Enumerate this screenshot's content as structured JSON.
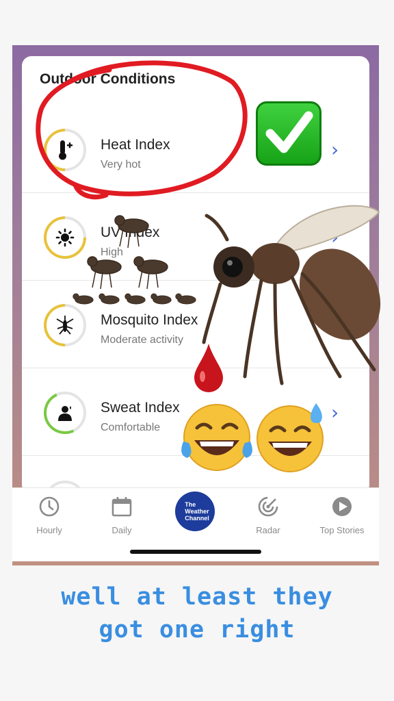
{
  "panel": {
    "title": "Outdoor Conditions",
    "rows": [
      {
        "title": "Heat Index",
        "subtitle": "Very hot",
        "icon": "thermometer-icon",
        "ring_color": "#e8c23a"
      },
      {
        "title": "UV Index",
        "subtitle": "High",
        "icon": "sun-icon",
        "ring_color": "#e8c23a"
      },
      {
        "title": "Mosquito Index",
        "subtitle": "Moderate activity",
        "icon": "mosquito-icon",
        "ring_color": "#e8c23a"
      },
      {
        "title": "Sweat Index",
        "subtitle": "Comfortable",
        "icon": "person-icon",
        "ring_color": "#7ac943"
      }
    ]
  },
  "tabs": [
    {
      "label": "Hourly",
      "icon": "clock-icon"
    },
    {
      "label": "Daily",
      "icon": "calendar-icon"
    },
    {
      "label": "Radar",
      "icon": "radar-icon"
    },
    {
      "label": "Top Stories",
      "icon": "play-icon"
    }
  ],
  "brand": {
    "line1": "The",
    "line2": "Weather",
    "line3": "Channel",
    "color": "#1d3c9b"
  },
  "caption": {
    "line1": "well at least they",
    "line2": "got one right"
  },
  "colors": {
    "accent": "#4a6cd4",
    "caption": "#3a8ee0",
    "scribble": "#e01b22"
  }
}
